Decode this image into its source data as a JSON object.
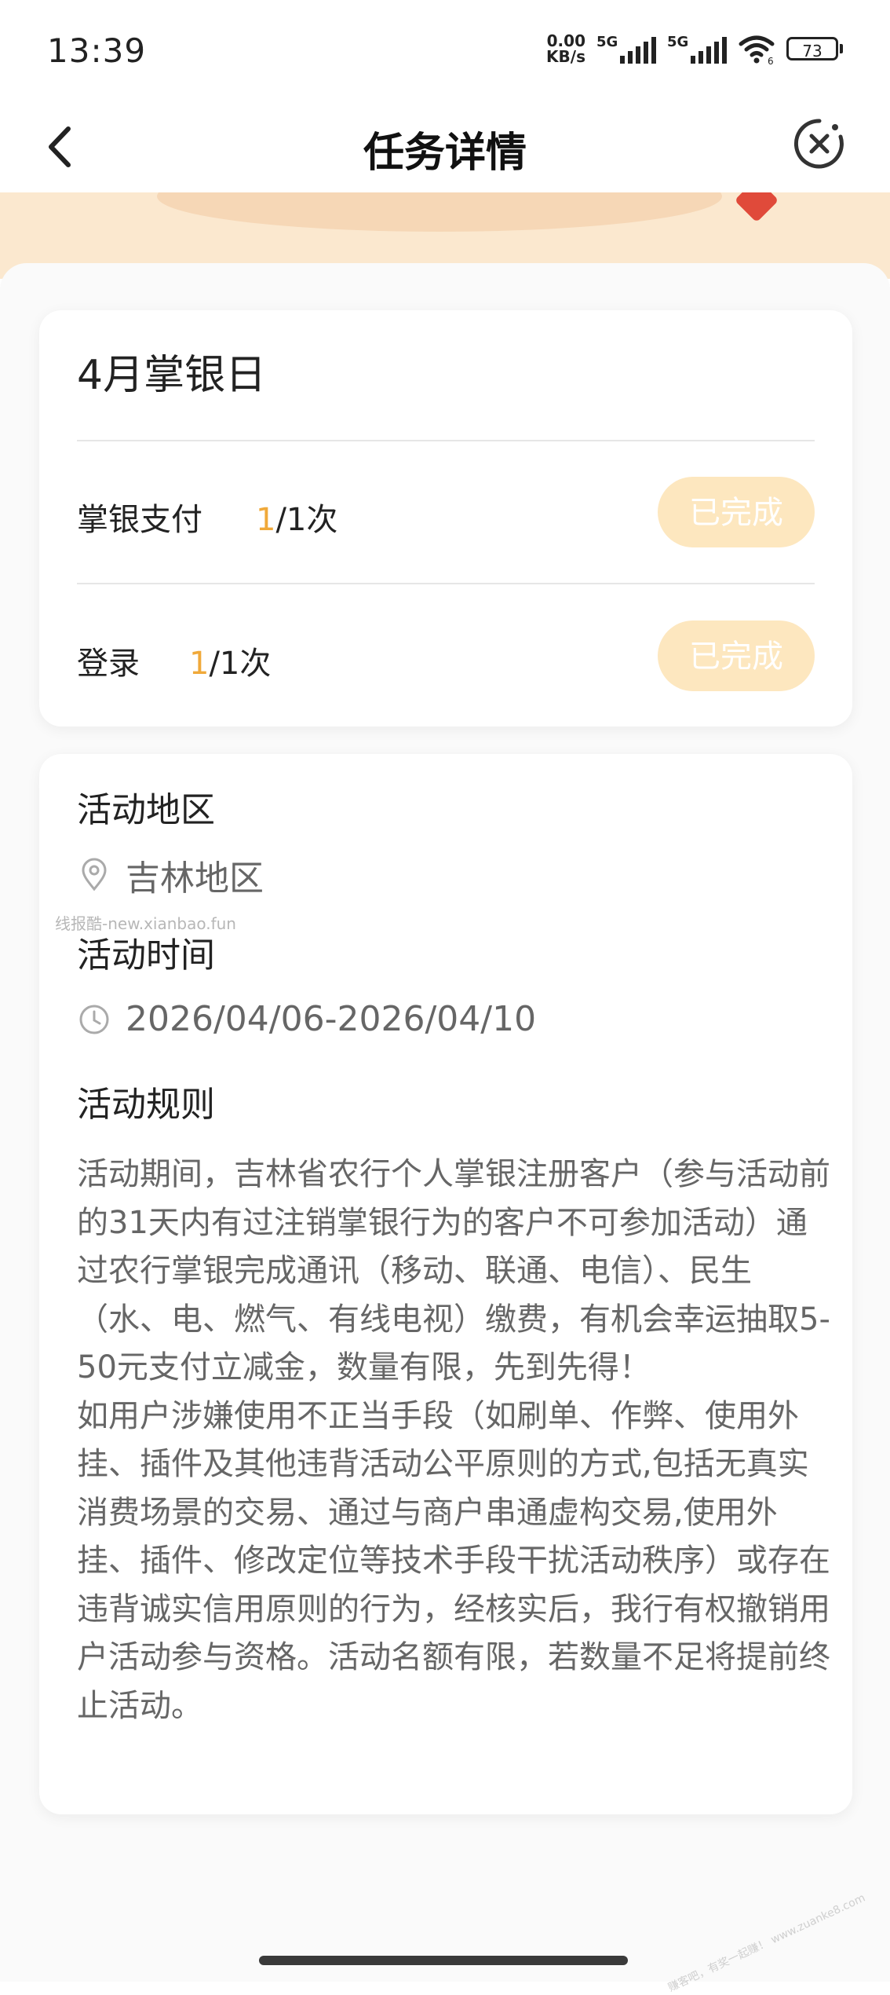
{
  "status_bar": {
    "time": "13:39",
    "net_speed_value": "0.00",
    "net_speed_unit": "KB/s",
    "sim1_tag": "5G",
    "sim2_tag": "5G",
    "wifi_badge": "6",
    "battery": "73"
  },
  "nav": {
    "title": "任务详情",
    "back_icon": "chevron-left-icon",
    "close_icon": "close-circle-icon"
  },
  "task_card": {
    "title": "4月掌银日",
    "tasks": [
      {
        "label": "掌银支付",
        "done": "1",
        "total": "/1次",
        "button": "已完成"
      },
      {
        "label": "登录",
        "done": "1",
        "total": "/1次",
        "button": "已完成"
      }
    ]
  },
  "activity": {
    "region_title": "活动地区",
    "region_value": "吉林地区",
    "time_title": "活动时间",
    "time_value": "2026/04/06-2026/04/10",
    "rules_title": "活动规则",
    "rules_p1": "活动期间，吉林省农行个人掌银注册客户（参与活动前的31天内有过注销掌银行为的客户不可参加活动）通过农行掌银完成通讯（移动、联通、电信）、民生（水、电、燃气、有线电视）缴费，有机会幸运抽取5-50元支付立减金，数量有限，先到先得！",
    "rules_p2": "如用户涉嫌使用不正当手段（如刷单、作弊、使用外挂、插件及其他违背活动公平原则的方式,包括无真实消费场景的交易、通过与商户串通虚构交易,使用外挂、插件、修改定位等技术手段干扰活动秩序）或存在违背诚实信用原则的行为，经核实后，我行有权撤销用户活动参与资格。活动名额有限，若数量不足将提前终止活动。"
  },
  "watermark": "线报酷-new.xianbao.fun",
  "corner_mark": "赚客吧，有奖一起赚！ www.zuanke8.com",
  "colors": {
    "accent": "#f0a93a",
    "done_button_bg": "#fde7bf",
    "banner_bg": "#fbe8cf",
    "page_bg": "#fafafa"
  }
}
